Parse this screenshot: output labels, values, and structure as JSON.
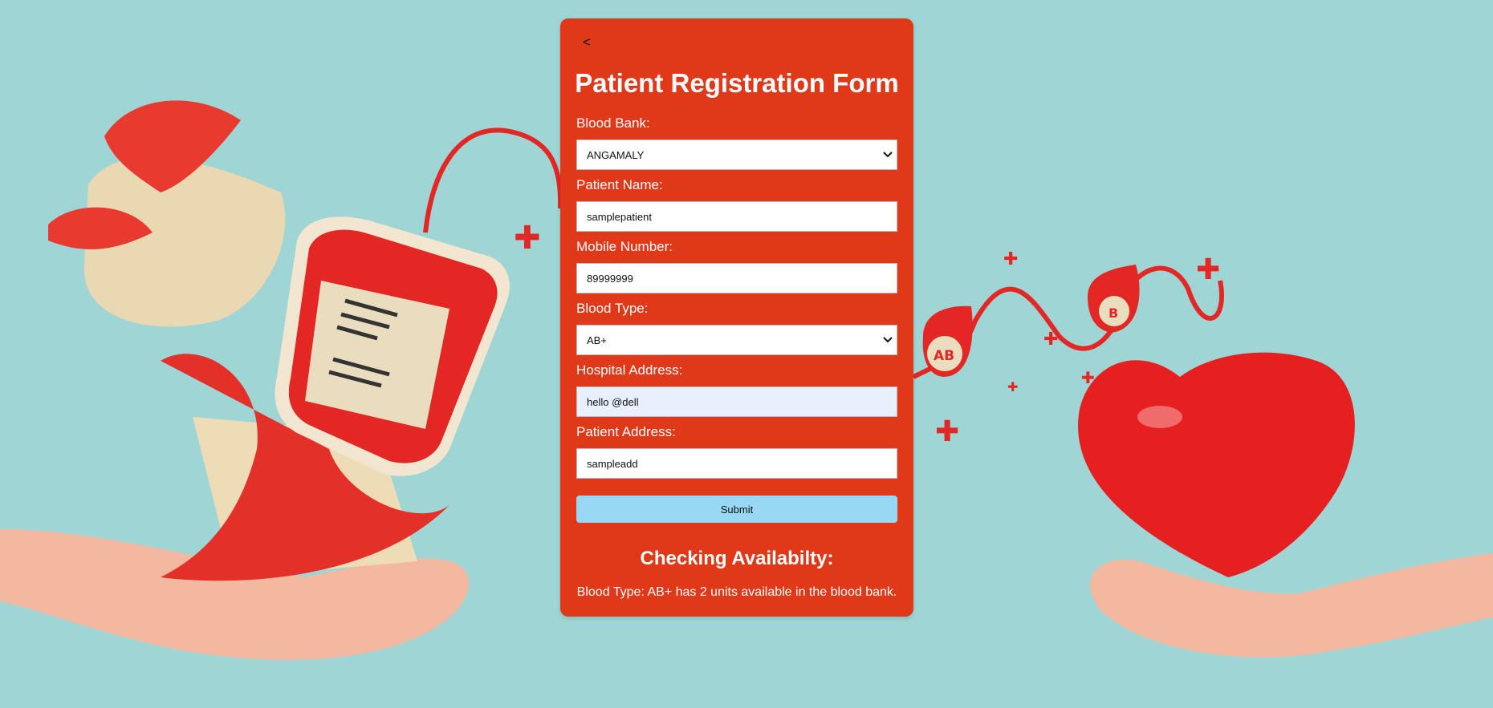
{
  "form": {
    "back_label": "<",
    "title": "Patient Registration Form",
    "fields": [
      {
        "label": "Blood Bank:",
        "type": "select",
        "value": "ANGAMALY"
      },
      {
        "label": "Patient Name:",
        "type": "text",
        "value": "samplepatient"
      },
      {
        "label": "Mobile Number:",
        "type": "text",
        "value": "89999999"
      },
      {
        "label": "Blood Type:",
        "type": "select",
        "value": "AB+"
      },
      {
        "label": "Hospital Address:",
        "type": "text",
        "value": "hello @dell"
      },
      {
        "label": "Patient Address:",
        "type": "text",
        "value": "sampleadd"
      }
    ],
    "submit_label": "Submit",
    "availability_title": "Checking Availabilty:",
    "availability_message": "Blood Type: AB+ has 2 units available in the blood bank."
  },
  "background": {
    "left_bag_icon": "blood-bag-icon",
    "right_heart_icon": "heart-icon",
    "drop_labels": [
      "AB",
      "B"
    ]
  },
  "colors": {
    "card": "#e0391a",
    "submit": "#98d8f4",
    "autofill": "#e8f0fe",
    "background": "#9fd6d5"
  }
}
